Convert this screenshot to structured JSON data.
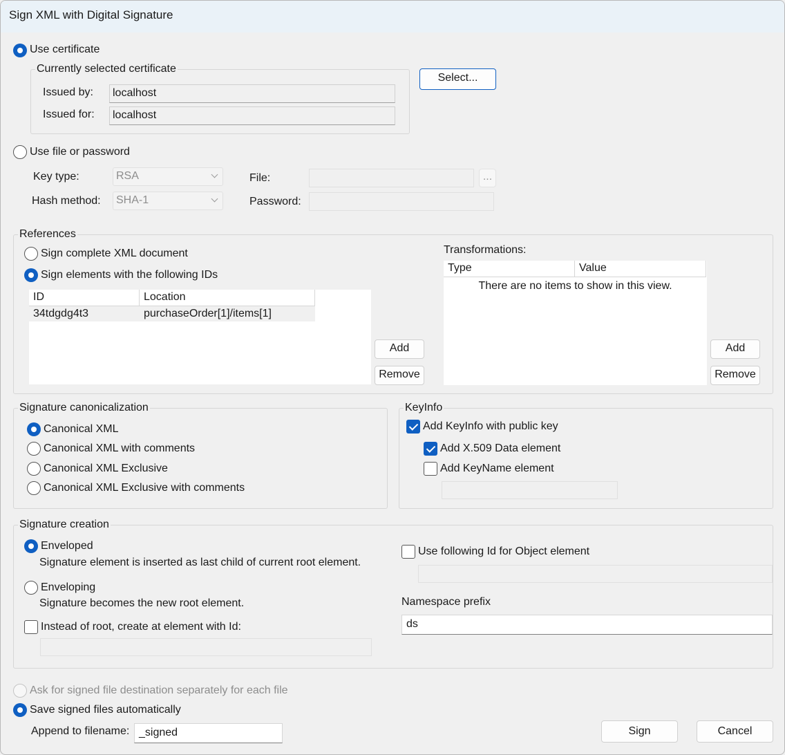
{
  "window": {
    "title": "Sign XML with Digital Signature"
  },
  "certificate": {
    "use_certificate_label": "Use certificate",
    "group_label": "Currently selected certificate",
    "issued_by_label": "Issued by:",
    "issued_by_value": "localhost",
    "issued_for_label": "Issued for:",
    "issued_for_value": "localhost",
    "select_button": "Select..."
  },
  "file_password": {
    "use_file_label": "Use file or password",
    "key_type_label": "Key type:",
    "key_type_value": "RSA",
    "hash_method_label": "Hash method:",
    "hash_method_value": "SHA-1",
    "file_label": "File:",
    "file_value": "",
    "browse_button": "...",
    "password_label": "Password:",
    "password_value": ""
  },
  "references": {
    "group_label": "References",
    "sign_complete_label": "Sign complete XML document",
    "sign_elements_label": "Sign elements with the following IDs",
    "columns": [
      "ID",
      "Location"
    ],
    "rows": [
      {
        "id": "34tdgdg4t3",
        "location": "purchaseOrder[1]/items[1]"
      }
    ],
    "add_button": "Add",
    "remove_button": "Remove",
    "transformations_label": "Transformations:",
    "transform_columns": [
      "Type",
      "Value"
    ],
    "transform_empty": "There are no items to show in this view.",
    "transform_add_button": "Add",
    "transform_remove_button": "Remove"
  },
  "canonicalization": {
    "group_label": "Signature canonicalization",
    "options": [
      "Canonical XML",
      "Canonical XML with comments",
      "Canonical XML Exclusive",
      "Canonical XML Exclusive with comments"
    ]
  },
  "keyinfo": {
    "group_label": "KeyInfo",
    "add_keyinfo_label": "Add KeyInfo with public key",
    "add_x509_label": "Add X.509 Data element",
    "add_keyname_label": "Add KeyName element",
    "keyname_value": ""
  },
  "creation": {
    "group_label": "Signature creation",
    "enveloped_label": "Enveloped",
    "enveloped_desc": "Signature element is inserted as last child of current root element.",
    "enveloping_label": "Enveloping",
    "enveloping_desc": "Signature becomes the new root element.",
    "instead_label": "Instead of root, create at element with Id:",
    "instead_value": "",
    "object_id_label": "Use following Id for Object element",
    "object_id_value": "",
    "namespace_label": "Namespace prefix",
    "namespace_value": "ds"
  },
  "output": {
    "ask_label": "Ask for signed file destination separately for each file",
    "save_auto_label": "Save signed files automatically",
    "append_label": "Append to filename:",
    "append_value": "_signed",
    "sign_button": "Sign",
    "cancel_button": "Cancel"
  },
  "colors": {
    "accent": "#0f5fc2",
    "title_bar": "#eaf2f8",
    "window_bg": "#f0f0f0"
  }
}
